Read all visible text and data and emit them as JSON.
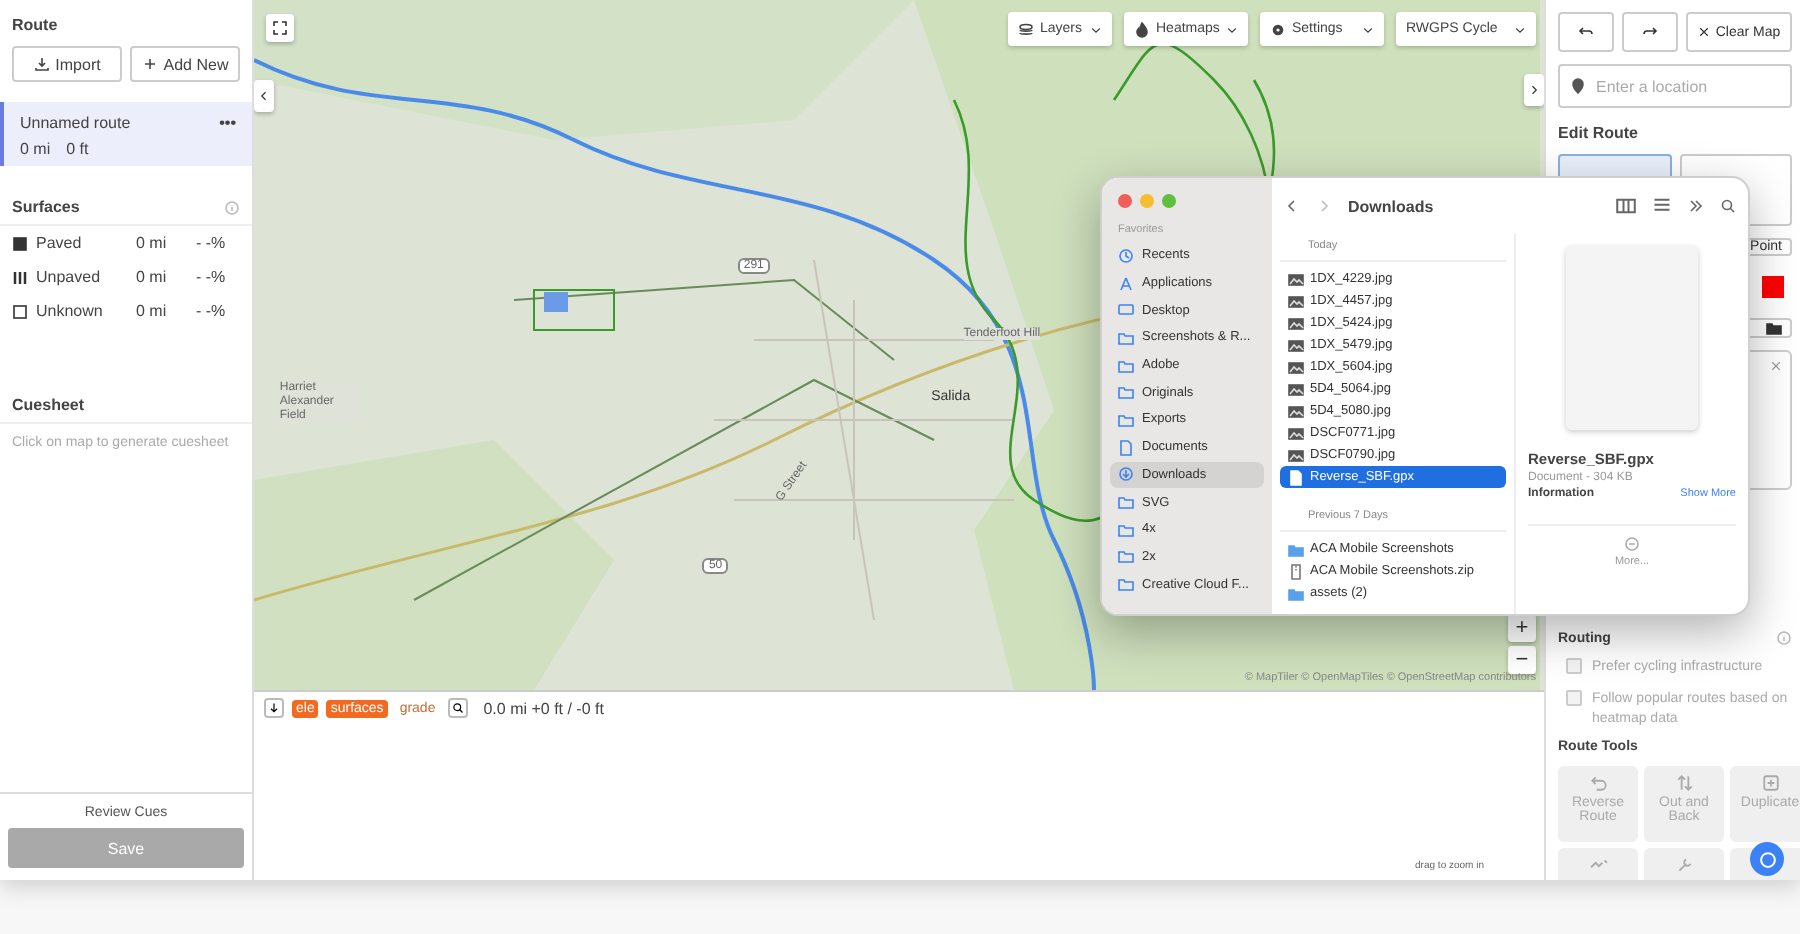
{
  "left_panel": {
    "route_title": "Route",
    "buttons": [
      {
        "kind": "import",
        "label": "Import"
      },
      {
        "kind": "add",
        "label": "Add New"
      }
    ],
    "route": {
      "name": "Unnamed route",
      "distance": "0 mi",
      "elevation": "0 ft",
      "menu": "•••",
      "selected": true
    },
    "surfaces": {
      "title": "Surfaces",
      "rows": [
        {
          "kind": "paved",
          "label": "Paved",
          "distance": "0 mi",
          "percent": "- -%"
        },
        {
          "kind": "unpaved",
          "label": "Unpaved",
          "distance": "0 mi",
          "percent": "- -%"
        },
        {
          "kind": "unknown",
          "label": "Unknown",
          "distance": "0 mi",
          "percent": "- -%"
        }
      ]
    },
    "cuesheet": {
      "title": "Cuesheet",
      "hint": "Click on map to generate cuesheet"
    },
    "review": "Review Cues",
    "save": {
      "label": "Save",
      "disabled": true
    }
  },
  "map": {
    "toolbar": [
      {
        "kind": "layers",
        "label": "Layers"
      },
      {
        "kind": "heatmaps",
        "label": "Heatmaps"
      },
      {
        "kind": "settings",
        "label": "Settings"
      },
      {
        "kind": "style",
        "label": "RWGPS Cycle"
      }
    ],
    "labels": [
      {
        "kind": "town",
        "text": "Salida"
      },
      {
        "kind": "place",
        "text": "Tenderfoot Hill"
      },
      {
        "kind": "place",
        "text": "Harriet Alexander Field"
      },
      {
        "kind": "street",
        "text": "G Street"
      },
      {
        "kind": "shield",
        "text": "291"
      },
      {
        "kind": "shield",
        "text": "50"
      }
    ],
    "zoom_in": "+",
    "zoom_out": "−",
    "attribution": "© MapTiler © OpenMapTiles © OpenStreetMap contributors"
  },
  "elevation_bar": {
    "tabs": [
      {
        "label": "ele",
        "selected": true
      },
      {
        "label": "surfaces",
        "selected": true
      },
      {
        "label": "grade",
        "selected": false
      }
    ],
    "summary": "0.0 mi +0 ft / -0 ft",
    "hint": "drag to zoom in"
  },
  "right_panel": {
    "clear": "Clear Map",
    "location": {
      "placeholder": "Enter a location"
    },
    "edit_title": "Edit Route",
    "modes": [
      {
        "kind": "draw",
        "selected": true
      },
      {
        "kind": "poi",
        "selected": false
      }
    ],
    "point_label": "Point",
    "routing_title": "Routing",
    "routing_options": [
      {
        "label": "Prefer cycling infrastructure",
        "checked": false
      },
      {
        "label": "Follow popular routes based on heatmap data",
        "checked": false
      }
    ],
    "tools_title": "Route Tools",
    "tools": [
      {
        "kind": "reverse",
        "label": "Reverse Route"
      },
      {
        "kind": "outback",
        "label": "Out and Back"
      },
      {
        "kind": "duplicate",
        "label": "Duplicate"
      },
      {
        "kind": "split"
      },
      {
        "kind": "wrench"
      },
      {
        "kind": "cursor"
      }
    ]
  },
  "finder": {
    "title": "Downloads",
    "favorites_title": "Favorites",
    "favorites": [
      {
        "kind": "clock",
        "label": "Recents",
        "selected": false
      },
      {
        "kind": "apps",
        "label": "Applications",
        "selected": false
      },
      {
        "kind": "desktop",
        "label": "Desktop",
        "selected": false
      },
      {
        "kind": "folder",
        "label": "Screenshots & R...",
        "selected": false
      },
      {
        "kind": "folder",
        "label": "Adobe",
        "selected": false
      },
      {
        "kind": "folder",
        "label": "Originals",
        "selected": false
      },
      {
        "kind": "folder",
        "label": "Exports",
        "selected": false
      },
      {
        "kind": "doc",
        "label": "Documents",
        "selected": false
      },
      {
        "kind": "download",
        "label": "Downloads",
        "selected": true
      },
      {
        "kind": "folder",
        "label": "SVG",
        "selected": false
      },
      {
        "kind": "folder",
        "label": "4x",
        "selected": false
      },
      {
        "kind": "folder",
        "label": "2x",
        "selected": false
      },
      {
        "kind": "folder",
        "label": "Creative Cloud F...",
        "selected": false
      }
    ],
    "groups": [
      {
        "title": "Today",
        "files": [
          {
            "kind": "image",
            "name": "1DX_4229.jpg",
            "selected": false
          },
          {
            "kind": "image",
            "name": "1DX_4457.jpg",
            "selected": false
          },
          {
            "kind": "image",
            "name": "1DX_5424.jpg",
            "selected": false
          },
          {
            "kind": "image",
            "name": "1DX_5479.jpg",
            "selected": false
          },
          {
            "kind": "image",
            "name": "1DX_5604.jpg",
            "selected": false
          },
          {
            "kind": "image",
            "name": "5D4_5064.jpg",
            "selected": false
          },
          {
            "kind": "image",
            "name": "5D4_5080.jpg",
            "selected": false
          },
          {
            "kind": "image",
            "name": "DSCF0771.jpg",
            "selected": false
          },
          {
            "kind": "image",
            "name": "DSCF0790.jpg",
            "selected": false
          },
          {
            "kind": "doc",
            "name": "Reverse_SBF.gpx",
            "selected": true
          }
        ]
      },
      {
        "title": "Previous 7 Days",
        "files": [
          {
            "kind": "folder",
            "name": "ACA Mobile Screenshots",
            "selected": false
          },
          {
            "kind": "zip",
            "name": "ACA Mobile Screenshots.zip",
            "selected": false
          },
          {
            "kind": "folder",
            "name": "assets (2)",
            "selected": false
          }
        ]
      }
    ],
    "preview": {
      "name": "Reverse_SBF.gpx",
      "type": "Document - 304 KB",
      "info": "Information",
      "show_more": "Show More",
      "more": "More..."
    }
  }
}
